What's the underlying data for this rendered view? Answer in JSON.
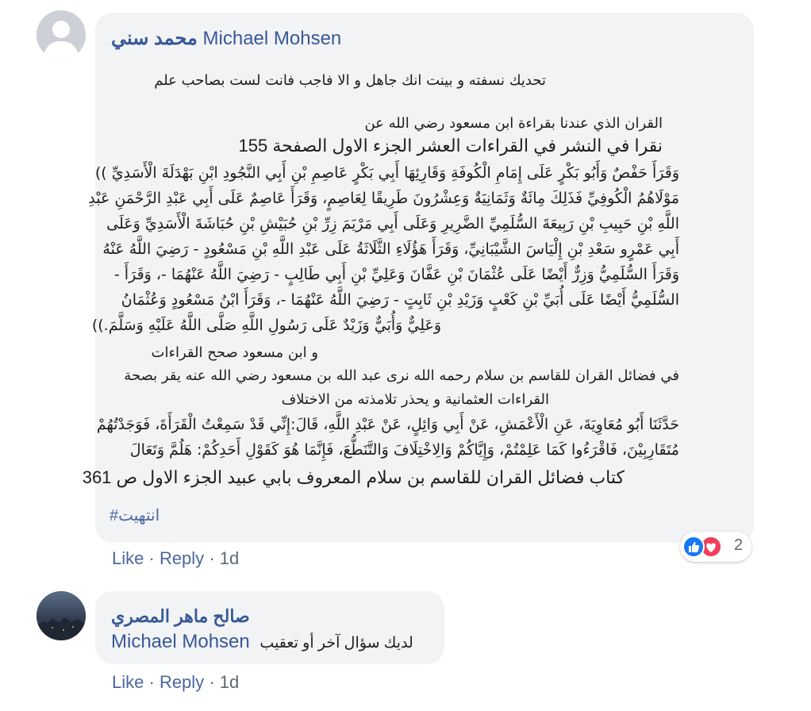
{
  "comment": {
    "author_ar": "محمد سني",
    "author_en": "Michael Mohsen",
    "lines": [
      "تحديك نسفته و بينت انك جاهل و الا فاجب فانت لست بصاحب علم",
      "القران الذي عندنا بقراءة ابن مسعود رضي الله عن",
      "نقرا في النشر في القراءات العشر الجزء الاول الصفحة 155",
      "وَقَرَأَ حَفْصٌ وَأَبُو بَكْرٍ عَلَى إِمَامِ الْكُوفَةِ وَقَارِئِهَا أَبِي بَكْرٍ عَاصِمِ بْنِ أَبِي النَّجُودِ ابْنِ بَهْدَلَةَ الْأَسَدِيِّ ))",
      "مَوْلَاهُمُ الْكُوفِيِّ فَذَلِكَ مِائَةٌ وَثَمَانِيَةٌ وَعِشْرُونَ طَرِيقًا لِعَاصِمٍ، وَقَرَأَ عَاصِمٌ عَلَى أَبِي عَبْدِ الرَّحْمَنِ عَبْدِ",
      "اللَّهِ بْنِ حَبِيبِ بْنِ رَبِيعَةَ السُّلَمِيِّ الضَّرِيرِ وَعَلَى أَبِي مَرْيَمَ زِرِّ بْنِ حُبَيْشِ بْنِ حُبَاشَةَ الْأَسَدِيِّ وَعَلَى",
      "أَبِي عَمْرٍو سَعْدِ بْنِ إِلْيَاسَ الشَّيْبَانِيِّ، وَقَرَأَ هَؤُلَاءِ الثَّلَاثَةُ عَلَى عَبْدِ اللَّهِ بْنِ مَسْعُودٍ - رَضِيَ اللَّهُ عَنْهُ",
      "وَقَرَأَ السُّلَمِيُّ وَزِرٌّ أَيْضًا عَلَى عُثْمَانَ بْنِ عَفَّانَ وَعَلِيِّ بْنِ أَبِي طَالِبٍ - رَضِيَ اللَّهُ عَنْهُمَا -، وَقَرَأَ -",
      "السُّلَمِيُّ أَيْضًا عَلَى أُبَيِّ بْنِ كَعْبٍ وَزَيْدِ بْنِ ثَابِتٍ - رَضِيَ اللَّهُ عَنْهُمَا -، وَقَرَأَ ابْنُ مَسْعُودٍ وَعُثْمَانُ",
      "وَعَلِيٌّ وَأُبَيٌّ وَزَيْدٌ عَلَى رَسُولِ اللَّهِ صَلَّى اللَّهُ عَلَيْهِ وَسَلَّمَ.))",
      "و ابن مسعود صحح القراءات",
      "في فضائل القران للقاسم بن سلام رحمه الله نرى عبد الله بن مسعود رضي الله عنه يقر بصحة",
      "القراءات العثمانية و يحذر تلامذته من الاختلاف",
      "حَدَّثَنَا أَبُو مُعَاوِيَةَ، عَنِ الْأَعْمَشِ، عَنْ أَبِي وَائِلٍ، عَنْ عَبْدِ اللَّهِ، قَالَ:إِنِّي قَدْ سَمِعْتُ الْقَرَأَةَ، فَوَجَدْتُهُمْ",
      "مُتَقَارِبِيْنَ، فَاقْرَءُوا كَمَا عَلِمْتُمْ، وَإِيَّاكُمْ وَالِاخْتِلَافَ وَالتَّنَطُّعَ، فَإِنَّمَا هُوَ كَقَوْلِ أَحَدِكُمْ: هَلُمَّ وَتَعَالَ",
      "كتاب فضائل القران للقاسم بن سلام المعروف بابي عبيد الجزء الاول ص 361"
    ],
    "hashtag": "#انتهيت",
    "actions": {
      "like": "Like",
      "reply": "Reply",
      "sep": "·",
      "time": "1d"
    },
    "reactions": {
      "count": "2",
      "colors": {
        "like": "#1877f2",
        "love": "#f33e58"
      }
    }
  },
  "reply": {
    "author": "صالح ماهر المصري",
    "mention": "Michael Mohsen",
    "text": "لديك سؤال آخر أو تعقيب",
    "actions": {
      "like": "Like",
      "reply": "Reply",
      "sep": "·",
      "time": "1d"
    }
  }
}
